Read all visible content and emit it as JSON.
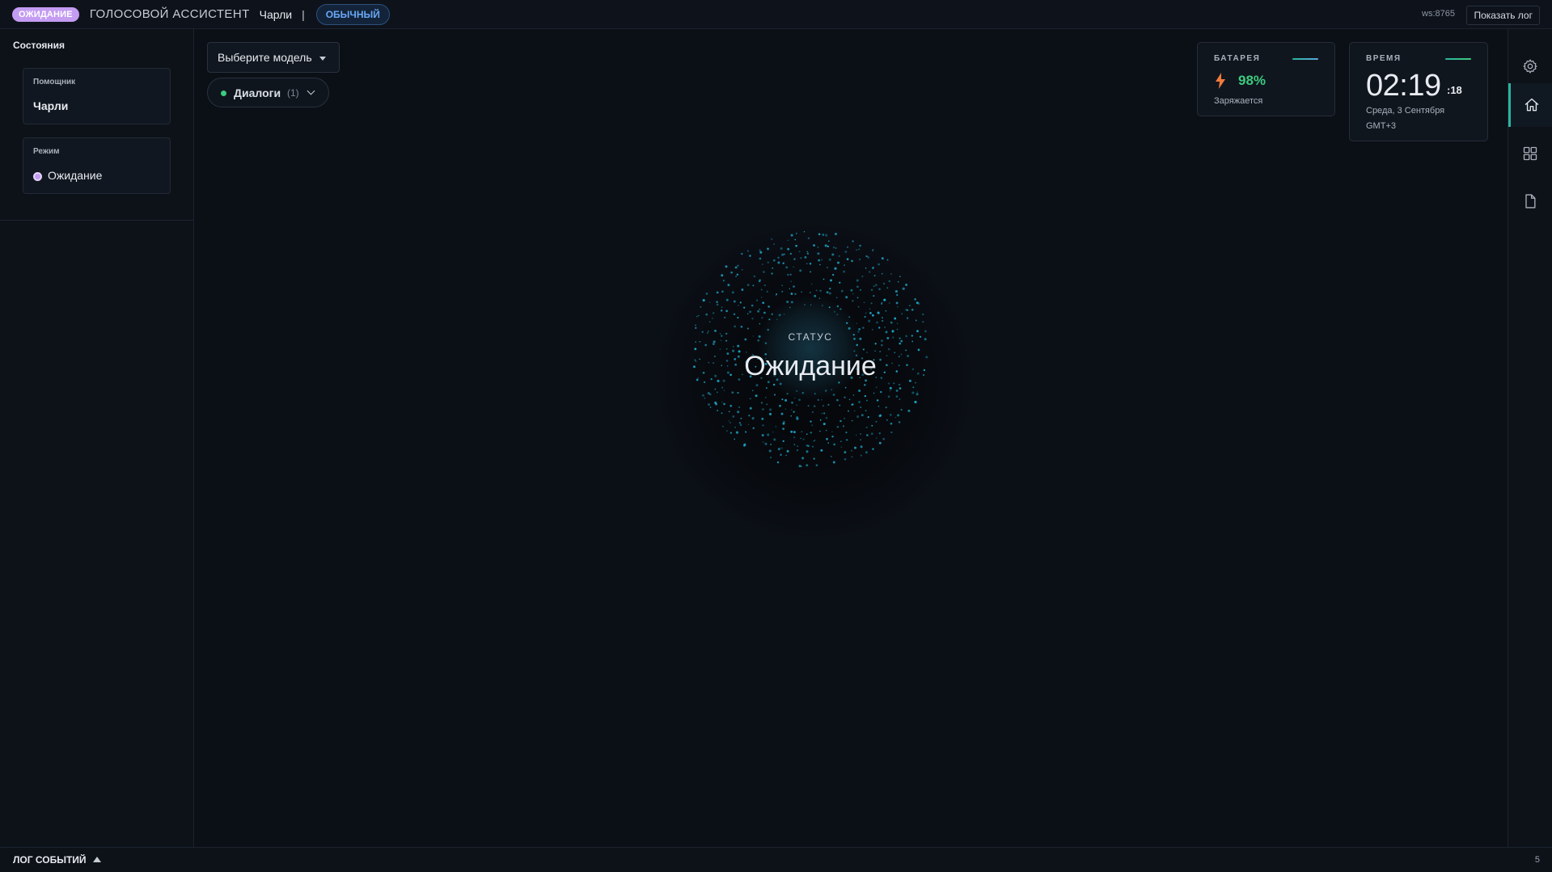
{
  "header": {
    "state_badge": "ОЖИДАНИЕ",
    "app_title": "ГОЛОСОВОЙ АССИСТЕНТ",
    "assistant_name": "Чарли",
    "separator": "|",
    "mode_badge": "ОБЫЧНЫЙ",
    "ws_label": "ws:8765",
    "show_log_label": "Показать лог"
  },
  "sidebar": {
    "title": "Состояния",
    "assistant_card": {
      "label": "Помощник",
      "value": "Чарли"
    },
    "mode_card": {
      "label": "Режим",
      "value": "Ожидание"
    }
  },
  "main": {
    "model_select": {
      "label": "Выберите модель"
    },
    "dialogs": {
      "label": "Диалоги",
      "count": "(1)"
    },
    "status": {
      "caption": "СТАТУС",
      "value": "Ожидание"
    }
  },
  "widgets": {
    "battery": {
      "title": "БАТАРЕЯ",
      "value": "98%",
      "status": "Заряжается"
    },
    "time": {
      "title": "ВРЕМЯ",
      "time": "02:19",
      "seconds": ":18",
      "date": "Среда, 3 Сентября",
      "timezone": "GMT+3"
    }
  },
  "right_rail": {
    "items": [
      {
        "icon": "gear-icon"
      },
      {
        "icon": "home-icon",
        "active": true
      },
      {
        "icon": "grid-icon"
      },
      {
        "icon": "document-icon"
      }
    ]
  },
  "bottom": {
    "log_label": "ЛОГ СОБЫТИЙ",
    "log_count": "5"
  },
  "colors": {
    "accent_purple": "#c49cf2",
    "accent_blue": "#6aa8f5",
    "accent_green": "#3ccb7f",
    "accent_teal": "#2bb5a0",
    "orb_dots": "#1fa8c9",
    "background": "#0b0f16"
  }
}
